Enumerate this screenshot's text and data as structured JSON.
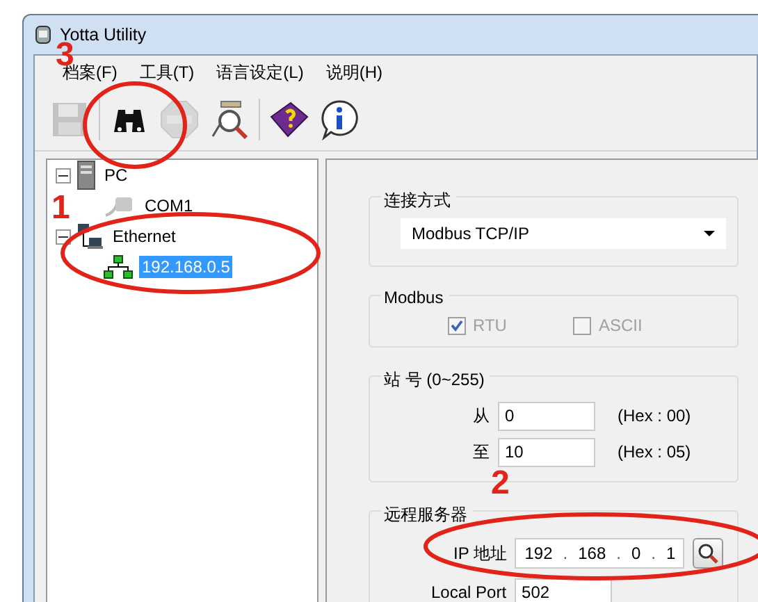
{
  "window": {
    "title": "Yotta Utility"
  },
  "menu": [
    "档案(F)",
    "工具(T)",
    "语言设定(L)",
    "说明(H)"
  ],
  "toolbar": [
    {
      "kind": "save",
      "disabled": true
    },
    {
      "kind": "binoculars",
      "disabled": false
    },
    {
      "kind": "stop",
      "disabled": true
    },
    {
      "kind": "scan",
      "disabled": false
    },
    {
      "kind": "help",
      "disabled": false
    },
    {
      "kind": "info",
      "disabled": false
    }
  ],
  "tree": [
    {
      "label": "PC",
      "kind": "pc",
      "expanded": true,
      "selected": false,
      "children": [
        {
          "label": "COM1",
          "kind": "serial",
          "selected": false
        }
      ]
    },
    {
      "label": "Ethernet",
      "kind": "ethernet",
      "expanded": true,
      "selected": false,
      "children": [
        {
          "label": "192.168.0.5",
          "kind": "network",
          "selected": true
        }
      ]
    }
  ],
  "connection": {
    "title": "连接方式",
    "value": "Modbus TCP/IP"
  },
  "modbus": {
    "title": "Modbus",
    "options": [
      {
        "label": "RTU",
        "checked": true,
        "disabled": true
      },
      {
        "label": "ASCII",
        "checked": false,
        "disabled": true
      }
    ]
  },
  "station": {
    "title": "站 号 (0~255)",
    "rows": [
      {
        "label": "从",
        "value": "0",
        "hex": "(Hex : 00)"
      },
      {
        "label": "至",
        "value": "10",
        "hex": "(Hex : 05)"
      }
    ]
  },
  "server": {
    "title": "远程服务器",
    "ip_label": "IP 地址",
    "ip_octets": [
      "192",
      "168",
      "0",
      "1"
    ],
    "ip_separator": ".",
    "port_label": "Local Port",
    "port": "502"
  },
  "annotations": [
    "3",
    "1",
    "2"
  ]
}
